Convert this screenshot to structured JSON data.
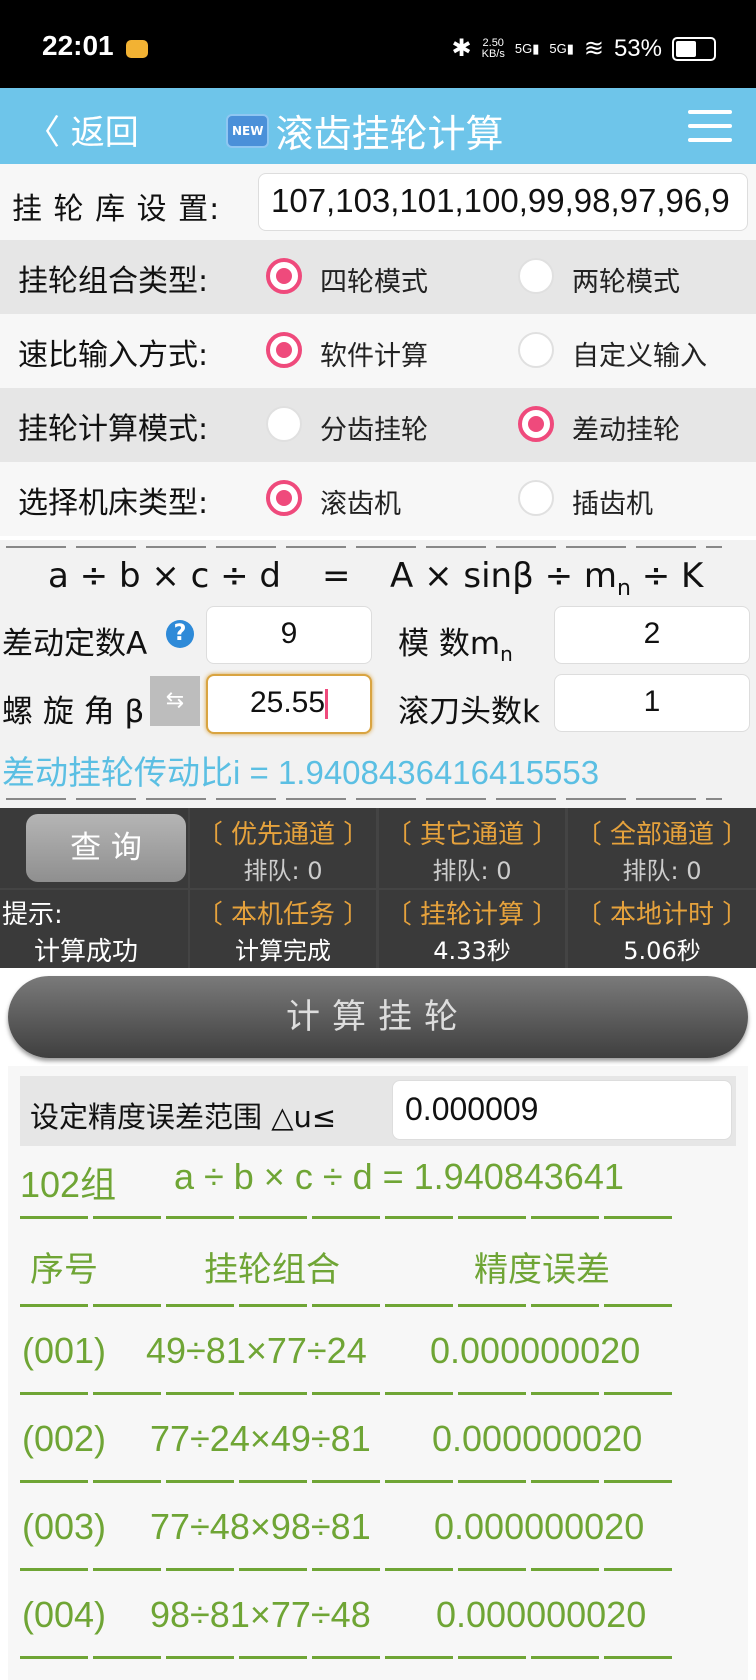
{
  "status_bar": {
    "time": "22:01",
    "net_speed_top": "2.50",
    "net_speed_unit": "KB/s",
    "sig1": "5G",
    "sig2": "5G",
    "battery": "53%"
  },
  "header": {
    "back_label": "〈 返回",
    "new_badge": "NEW",
    "title": "滚齿挂轮计算",
    "icons": [
      "back-chevron-icon",
      "new-badge-icon",
      "hamburger-menu-icon"
    ]
  },
  "settings": {
    "library": {
      "label": "挂 轮 库 设 置:",
      "value": "107,103,101,100,99,98,97,96,9"
    },
    "combo_type": {
      "label": "挂轮组合类型:",
      "options": [
        "四轮模式",
        "两轮模式"
      ],
      "selected": 0
    },
    "ratio_input": {
      "label": "速比输入方式:",
      "options": [
        "软件计算",
        "自定义输入"
      ],
      "selected": 0
    },
    "calc_mode": {
      "label": "挂轮计算模式:",
      "options": [
        "分齿挂轮",
        "差动挂轮"
      ],
      "selected": 1
    },
    "machine_type": {
      "label": "选择机床类型:",
      "options": [
        "滚齿机",
        "插齿机"
      ],
      "selected": 0
    }
  },
  "formula": {
    "lhs": "a ÷ b × c ÷ d",
    "eq": "=",
    "rhs_pre": "A × sinβ ÷ m",
    "rhs_sub": "n",
    "rhs_post": " ÷ K",
    "const_label": "差动定数A",
    "const_value": "9",
    "module_label": "模    数m",
    "module_sub": "n",
    "module_value": "2",
    "helix_label": "螺 旋 角 β",
    "helix_value": "25.55",
    "hob_label": "滚刀头数k",
    "hob_value": "1",
    "ratio_text": "差动挂轮传动比i = 1.9408436416415553"
  },
  "queue": {
    "query_button": "查 询",
    "channels": [
      {
        "title": "〔 优先通道 〕",
        "sub": "排队: 0"
      },
      {
        "title": "〔 其它通道 〕",
        "sub": "排队: 0"
      },
      {
        "title": "〔 全部通道 〕",
        "sub": "排队: 0"
      }
    ],
    "hint_label": "提示:",
    "hint_value": "计算成功",
    "stats": [
      {
        "title": "〔 本机任务 〕",
        "sub": "计算完成"
      },
      {
        "title": "〔 挂轮计算 〕",
        "sub": "4.33秒"
      },
      {
        "title": "〔 本地计时 〕",
        "sub": "5.06秒"
      }
    ]
  },
  "calc_button": "计算挂轮",
  "results": {
    "precision_label": "设定精度误差范围 △u≤",
    "precision_value": "0.000009",
    "summary_count": "102组",
    "summary_formula": "a ÷ b × c ÷ d = 1.940843641",
    "headers": [
      "序号",
      "挂轮组合",
      "精度误差"
    ],
    "rows": [
      {
        "idx": "(001)",
        "combo": "49÷81×77÷24",
        "err": "0.000000020"
      },
      {
        "idx": "(002)",
        "combo": "77÷24×49÷81",
        "err": "0.000000020"
      },
      {
        "idx": "(003)",
        "combo": "77÷48×98÷81",
        "err": "0.000000020"
      },
      {
        "idx": "(004)",
        "combo": "98÷81×77÷48",
        "err": "0.000000020"
      }
    ]
  },
  "colors": {
    "accent_blue": "#6ec5ea",
    "radio_pink": "#ef4a7c",
    "result_green": "#6fa535",
    "queue_orange": "#e6a23c"
  }
}
